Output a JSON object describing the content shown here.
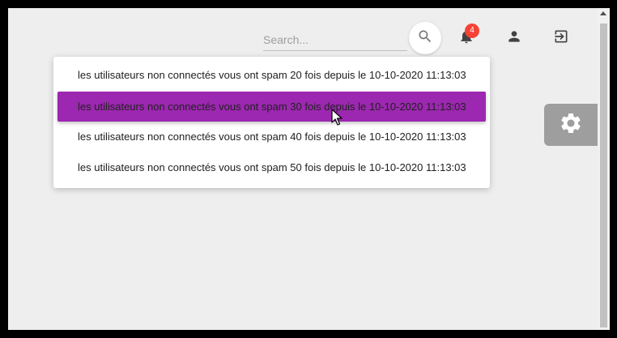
{
  "header": {
    "search": {
      "placeholder": "Search...",
      "value": ""
    },
    "search_icon": "search-icon",
    "notifications": {
      "icon": "bell-icon",
      "badge_count": "4",
      "badge_color": "#f44336"
    },
    "account_icon": "person-icon",
    "logout_icon": "exit-to-app-icon"
  },
  "notifications_menu": {
    "items": [
      {
        "text": "les utilisateurs non connectés vous ont spam 20 fois depuis le 10-10-2020 11:13:03",
        "highlighted": false
      },
      {
        "text": "les utilisateurs non connectés vous ont spam 30 fois depuis le 10-10-2020 11:13:03",
        "highlighted": true
      },
      {
        "text": "les utilisateurs non connectés vous ont spam 40 fois depuis le 10-10-2020 11:13:03",
        "highlighted": false
      },
      {
        "text": "les utilisateurs non connectés vous ont spam 50 fois depuis le 10-10-2020 11:13:03",
        "highlighted": false
      }
    ],
    "highlight_color": "#9c27b0"
  },
  "settings_tab": {
    "icon": "gear-icon",
    "color": "#9e9e9e"
  }
}
